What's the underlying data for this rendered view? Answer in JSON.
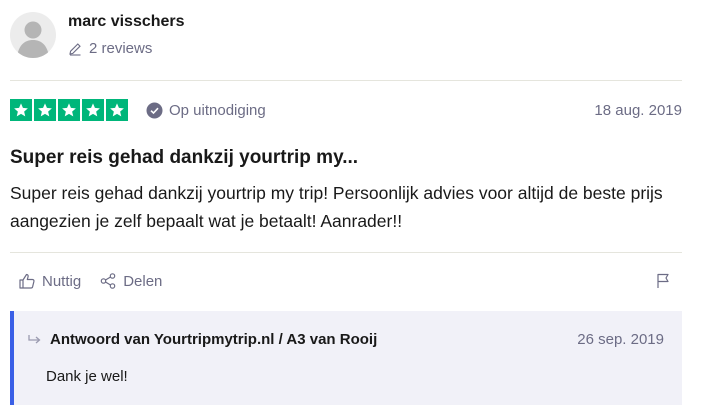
{
  "consumer": {
    "name": "marc visschers",
    "reviews_count": "2 reviews",
    "avatar_icon": "person-silhouette-icon"
  },
  "review": {
    "rating_stars": 5,
    "rating_max": 5,
    "star_color": "#00b67a",
    "verification_label": "Op uitnodiging",
    "date": "18 aug. 2019",
    "title": "Super reis gehad dankzij yourtrip my...",
    "text": "Super reis gehad dankzij yourtrip my trip! Persoonlijk advies voor altijd de beste prijs aangezien je zelf bepaalt wat je betaalt! Aanrader!!"
  },
  "actions": {
    "useful_label": "Nuttig",
    "share_label": "Delen",
    "flag_icon": "flag-icon"
  },
  "reply": {
    "author": "Antwoord van Yourtripmytrip.nl / A3 van Rooij",
    "date": "26 sep. 2019",
    "text": "Dank je wel!",
    "accent_color": "#3a5fe6"
  }
}
